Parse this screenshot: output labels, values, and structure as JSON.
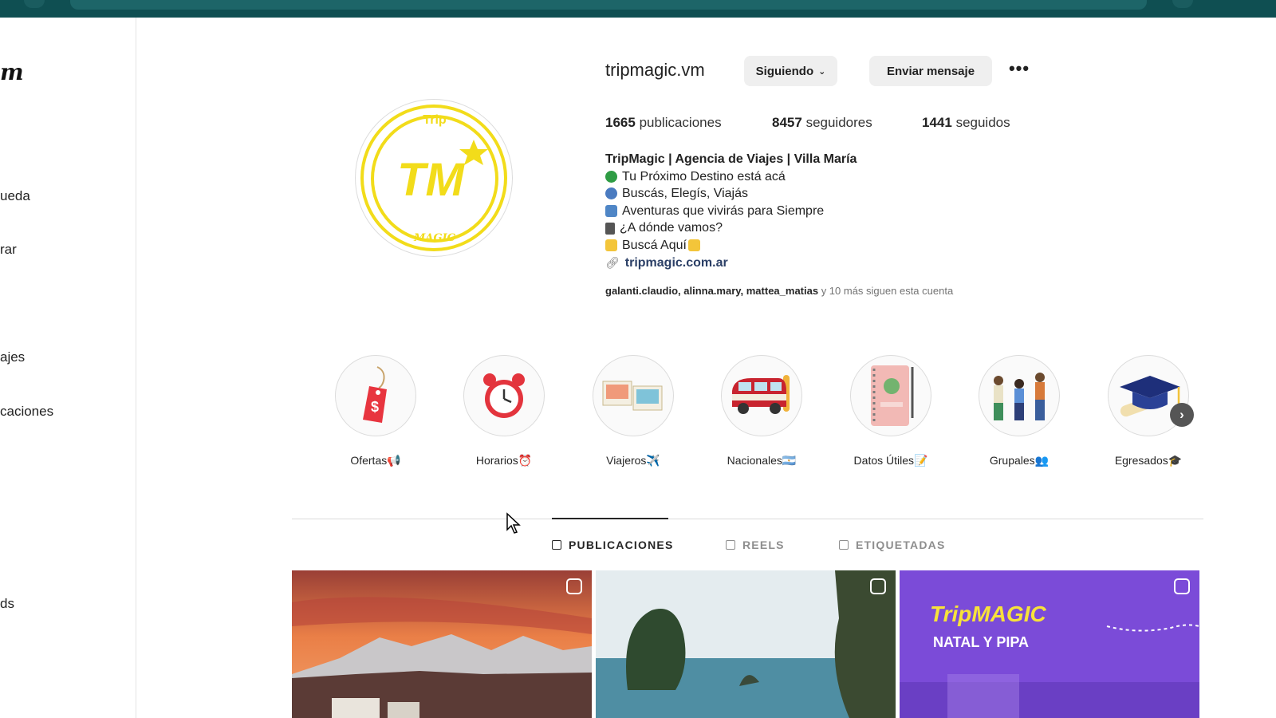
{
  "sidebar": {
    "logo": "m",
    "items": [
      {
        "label": "ueda",
        "icon": "search-icon"
      },
      {
        "label": "rar",
        "icon": "compass-icon"
      },
      {
        "label": "ajes",
        "icon": "messenger-icon"
      },
      {
        "label": "caciones",
        "icon": "heart-icon"
      },
      {
        "label": "ds",
        "icon": "threads-icon"
      }
    ]
  },
  "profile": {
    "username": "tripmagic.vm",
    "following_button": "Siguiendo",
    "message_button": "Enviar mensaje",
    "more_icon": "more-horizontal-icon",
    "avatar_text": {
      "top": "Trip",
      "mark": "TM",
      "bottom": "MAGIC"
    },
    "stats": {
      "posts_count": "1665",
      "posts_label": "publicaciones",
      "followers_count": "8457",
      "followers_label": "seguidores",
      "following_count": "1441",
      "following_label": "seguidos"
    },
    "bio": {
      "name": "TripMagic | Agencia de Viajes | Villa María",
      "lines": [
        {
          "icon": "globe-icon",
          "text": "Tu Próximo Destino está acá"
        },
        {
          "icon": "magnifier-icon",
          "text": "Buscás, Elegís, Viajás"
        },
        {
          "icon": "airplane-icon",
          "text": "Aventuras que vivirás para Siempre"
        },
        {
          "icon": "clipboard-icon",
          "text": "¿A dónde vamos?"
        },
        {
          "icon": "pointing-down-icon",
          "text": "Buscá Aquí"
        }
      ],
      "link": "tripmagic.com.ar"
    },
    "followed_by": {
      "names": "galanti.claudio, alinna.mary, mattea_matias",
      "rest": " y 10 más siguen esta cuenta"
    }
  },
  "highlights": [
    {
      "label": "Ofertas📢",
      "icon": "price-tag-icon"
    },
    {
      "label": "Horarios⏰",
      "icon": "alarm-clock-icon"
    },
    {
      "label": "Viajeros✈️",
      "icon": "photos-icon"
    },
    {
      "label": "Nacionales🇦🇷",
      "icon": "van-icon"
    },
    {
      "label": "Datos Útiles📝",
      "icon": "notebook-icon"
    },
    {
      "label": "Grupales👥",
      "icon": "group-icon"
    },
    {
      "label": "Egresados🎓",
      "icon": "graduation-cap-icon"
    }
  ],
  "tabs": [
    {
      "label": "PUBLICACIONES",
      "icon": "grid-icon",
      "active": true
    },
    {
      "label": "REELS",
      "icon": "reels-icon",
      "active": false
    },
    {
      "label": "ETIQUETADAS",
      "icon": "tagged-icon",
      "active": false
    }
  ],
  "posts": [
    {
      "type": "reel",
      "badge_icon": "reel-badge-icon"
    },
    {
      "type": "reel",
      "badge_icon": "reel-badge-icon"
    },
    {
      "type": "carousel",
      "badge_icon": "carousel-badge-icon",
      "brand": "TripMAGIC",
      "title": "NATAL Y PIPA"
    }
  ],
  "colors": {
    "accent_yellow": "#f2dc1a",
    "button_bg": "#efefef",
    "topbar": "#0f4f52",
    "post3_bg": "#7b4bd8"
  }
}
